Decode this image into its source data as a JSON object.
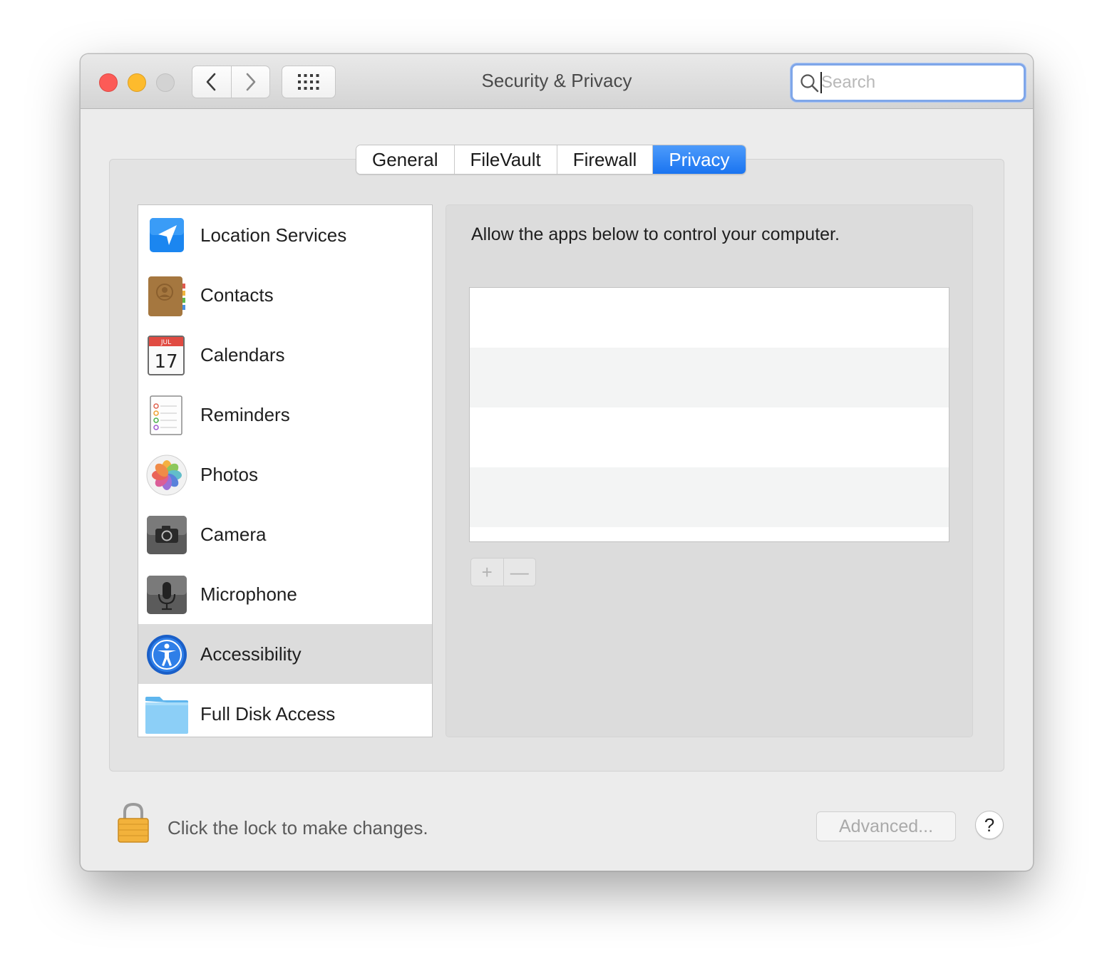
{
  "window": {
    "title": "Security & Privacy"
  },
  "search": {
    "placeholder": "Search",
    "value": ""
  },
  "tabs": [
    {
      "label": "General",
      "active": false
    },
    {
      "label": "FileVault",
      "active": false
    },
    {
      "label": "Firewall",
      "active": false
    },
    {
      "label": "Privacy",
      "active": true
    }
  ],
  "sidebar": {
    "items": [
      {
        "label": "Location Services",
        "icon": "location-arrow-icon"
      },
      {
        "label": "Contacts",
        "icon": "contacts-book-icon"
      },
      {
        "label": "Calendars",
        "icon": "calendar-icon",
        "icon_month": "JUL",
        "icon_day": "17"
      },
      {
        "label": "Reminders",
        "icon": "reminders-icon"
      },
      {
        "label": "Photos",
        "icon": "photos-pinwheel-icon"
      },
      {
        "label": "Camera",
        "icon": "camera-icon"
      },
      {
        "label": "Microphone",
        "icon": "microphone-icon"
      },
      {
        "label": "Accessibility",
        "icon": "accessibility-icon",
        "selected": true
      },
      {
        "label": "Full Disk Access",
        "icon": "folder-icon"
      }
    ]
  },
  "main": {
    "description": "Allow the apps below to control your computer.",
    "add_label": "+",
    "remove_label": "—"
  },
  "footer": {
    "lock_text": "Click the lock to make changes.",
    "advanced_label": "Advanced...",
    "help_label": "?"
  },
  "colors": {
    "accent": "#1a74f0",
    "close": "#fc5b57",
    "minimize": "#fdbb2d"
  }
}
